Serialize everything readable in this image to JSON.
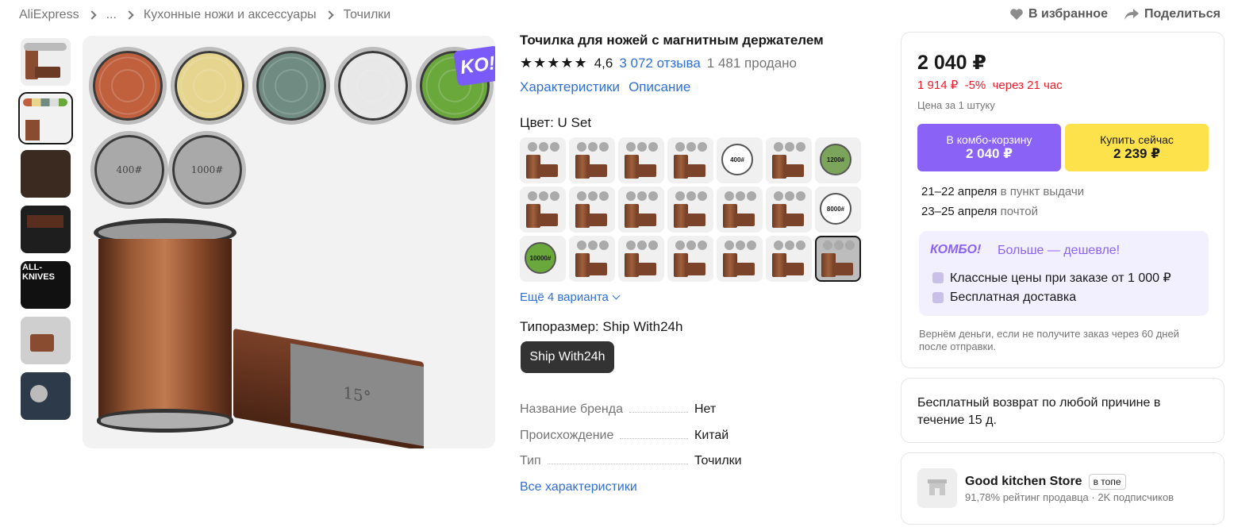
{
  "breadcrumb": {
    "items": [
      "AliExpress",
      "...",
      "Кухонные ножи и аксессуары",
      "Точилки"
    ]
  },
  "top_actions": {
    "favorite": "В избранное",
    "share": "Поделиться"
  },
  "gallery": {
    "badge": "KO!",
    "disc_labels": [
      "400#",
      "1000#"
    ],
    "block_label": "15°",
    "disc_colors": [
      "#c0603d",
      "#e6d58e",
      "#6f8b82",
      "#e8e8e8",
      "#6aa83c"
    ],
    "thumb_text": "ALL-KNIVES"
  },
  "product": {
    "title": "Точилка для ножей с магнитным держателем",
    "stars": "★★★★★",
    "rating": "4,6",
    "reviews": "3 072 отзыва",
    "sold": "1 481 продано",
    "tab_specs": "Характеристики",
    "tab_desc": "Описание",
    "color_label": "Цвет: U Set",
    "more_variants": "Ещё 4 варианта",
    "size_label": "Типоразмер: Ship With24h",
    "size_option": "Ship With24h",
    "specs": [
      {
        "key": "Название бренда",
        "value": "Нет"
      },
      {
        "key": "Происхождение",
        "value": "Китай"
      },
      {
        "key": "Тип",
        "value": "Точилки"
      }
    ],
    "all_specs": "Все характеристики"
  },
  "buy_box": {
    "price": "2 040 ₽",
    "discount_line": "1 914 ₽  -5%  через 21 час",
    "unit_note": "Цена за 1 штуку",
    "combo_btn_top": "В комбо-корзину",
    "combo_btn_price": "2 040 ₽",
    "buy_btn_top": "Купить сейчас",
    "buy_btn_price": "2 239 ₽",
    "delivery1_date": "21–22 апреля",
    "delivery1_where": " в пункт выдачи",
    "delivery2_date": "23–25 апреля",
    "delivery2_where": " почтой",
    "combo_logo": "КОМБО!",
    "combo_tagline": "Больше — дешевле!",
    "combo_line1": "Классные цены при заказе от 1 000 ₽",
    "combo_line2": "Бесплатная доставка",
    "refund": "Вернём деньги, если не получите заказ через 60 дней после отправки."
  },
  "returns": {
    "text": "Бесплатный возврат по любой причине в течение 15 д."
  },
  "store": {
    "name": "Good kitchen Store",
    "badge": "в топе",
    "sub": "91,78% рейтинг продавца · 2K подписчиков"
  },
  "variant_labels": [
    "400#",
    "1200#",
    "8000#",
    "10000#"
  ]
}
